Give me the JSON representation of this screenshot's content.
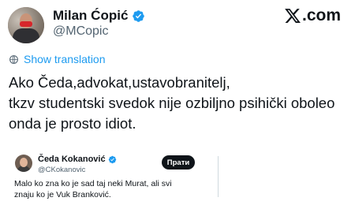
{
  "post": {
    "author_name": "Milan Ćopić",
    "author_handle": "@MCopic",
    "platform_name": ".com",
    "translate_label": "Show translation",
    "text_lines": [
      "Ako Čeda,advokat,ustavobranitelj,",
      "tkzv studentski svedok nije ozbiljno psihički oboleo",
      "onda je prosto idiot."
    ]
  },
  "quoted": {
    "author_name": "Čeda Kokanović",
    "author_handle": "@CKokanovic",
    "follow_label": "Прати",
    "text_lines": [
      "Malo ko zna ko je sad taj neki Murat, ali svi",
      "znaju ko je Vuk Branković."
    ]
  },
  "colors": {
    "link": "#1d9bf0",
    "verified": "#1d9bf0",
    "secondary_text": "#536471",
    "primary_text": "#0f1419"
  },
  "icons": {
    "verified": "verified-badge-icon",
    "platform": "x-logo-icon",
    "translate": "globe-icon"
  }
}
